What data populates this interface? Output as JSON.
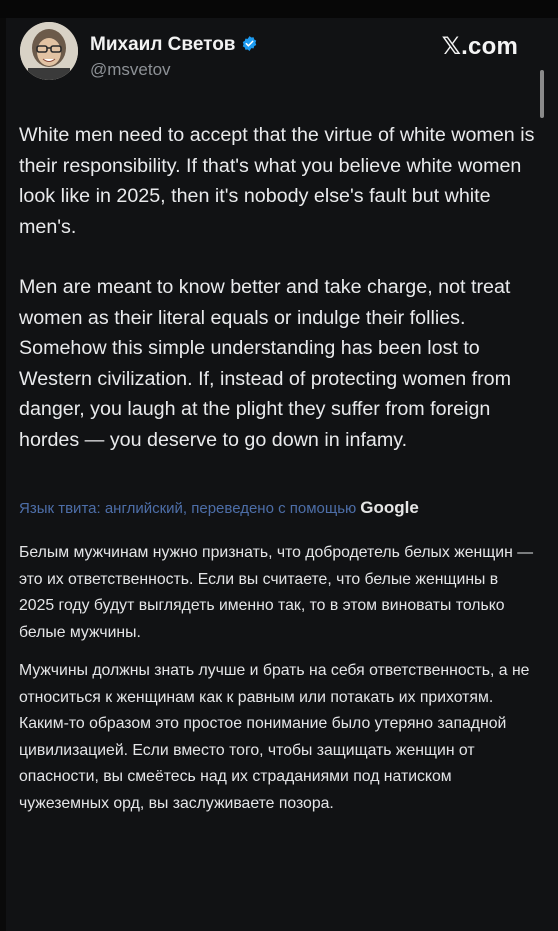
{
  "author": {
    "name": "Михаил Светов",
    "handle": "@msvetov",
    "verified": true
  },
  "brand": {
    "logo_text": "𝕏.com"
  },
  "tweet": {
    "paragraphs": [
      "White men need to accept that the virtue of white women is their responsibility. If that's what you believe white women look like in 2025, then it's nobody else's fault but white men's.",
      "Men are meant to know better and take charge, not treat women as their literal equals or indulge their follies. Somehow this simple understanding has been lost to Western civilization. If, instead of protecting women from danger, you laugh at the plight they suffer from foreign hordes — you deserve to go down in infamy."
    ]
  },
  "translation": {
    "label": "Язык твита: английский, переведено с помощью",
    "provider": "Google",
    "paragraphs": [
      "Белым мужчинам нужно признать, что добродетель белых женщин — это их ответственность. Если вы считаете, что белые женщины в 2025 году будут выглядеть именно так, то в этом виноваты только белые мужчины.",
      "Мужчины должны знать лучше и брать на себя ответственность, а не относиться к женщинам как к равным или потакать их прихотям. Каким-то образом это простое понимание было утеряно западной цивилизацией. Если вместо того, чтобы защищать женщин от опасности, вы смеётесь над их страданиями под натиском чужеземных орд, вы заслуживаете позора."
    ]
  },
  "colors": {
    "background": "#111214",
    "text": "#e9eaec",
    "muted": "#8d9196",
    "link": "#4d6ea8",
    "verified": "#1d9bf0"
  },
  "icons": [
    "verified-badge-icon",
    "avatar"
  ]
}
